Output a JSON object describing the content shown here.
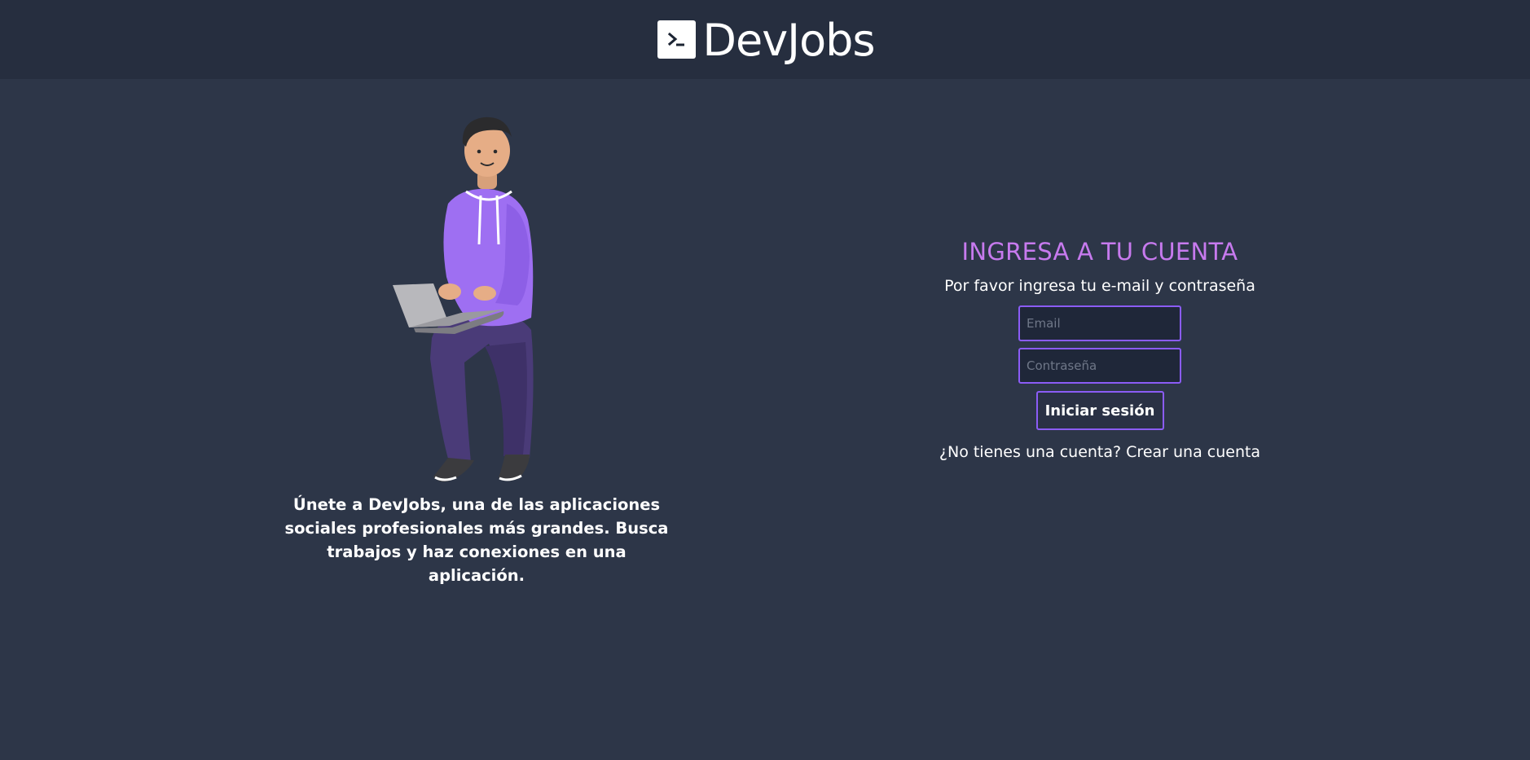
{
  "header": {
    "brand_name": "DevJobs",
    "brand_icon": "terminal-icon"
  },
  "hero": {
    "description": "Únete a DevJobs, una de las aplicaciones sociales profesionales más grandes. Busca trabajos y haz conexiones en una aplicación."
  },
  "login": {
    "title": "INGRESA A TU CUENTA",
    "subtitle": "Por favor ingresa tu e-mail y contraseña",
    "email_placeholder": "Email",
    "password_placeholder": "Contraseña",
    "submit_label": "Iniciar sesión",
    "signup_prompt": "¿No tienes una cuenta?",
    "signup_link": "Crear una cuenta"
  },
  "colors": {
    "background": "#2d3648",
    "header_background": "#262e3f",
    "accent": "#8b5cf6",
    "title": "#c77aee"
  }
}
